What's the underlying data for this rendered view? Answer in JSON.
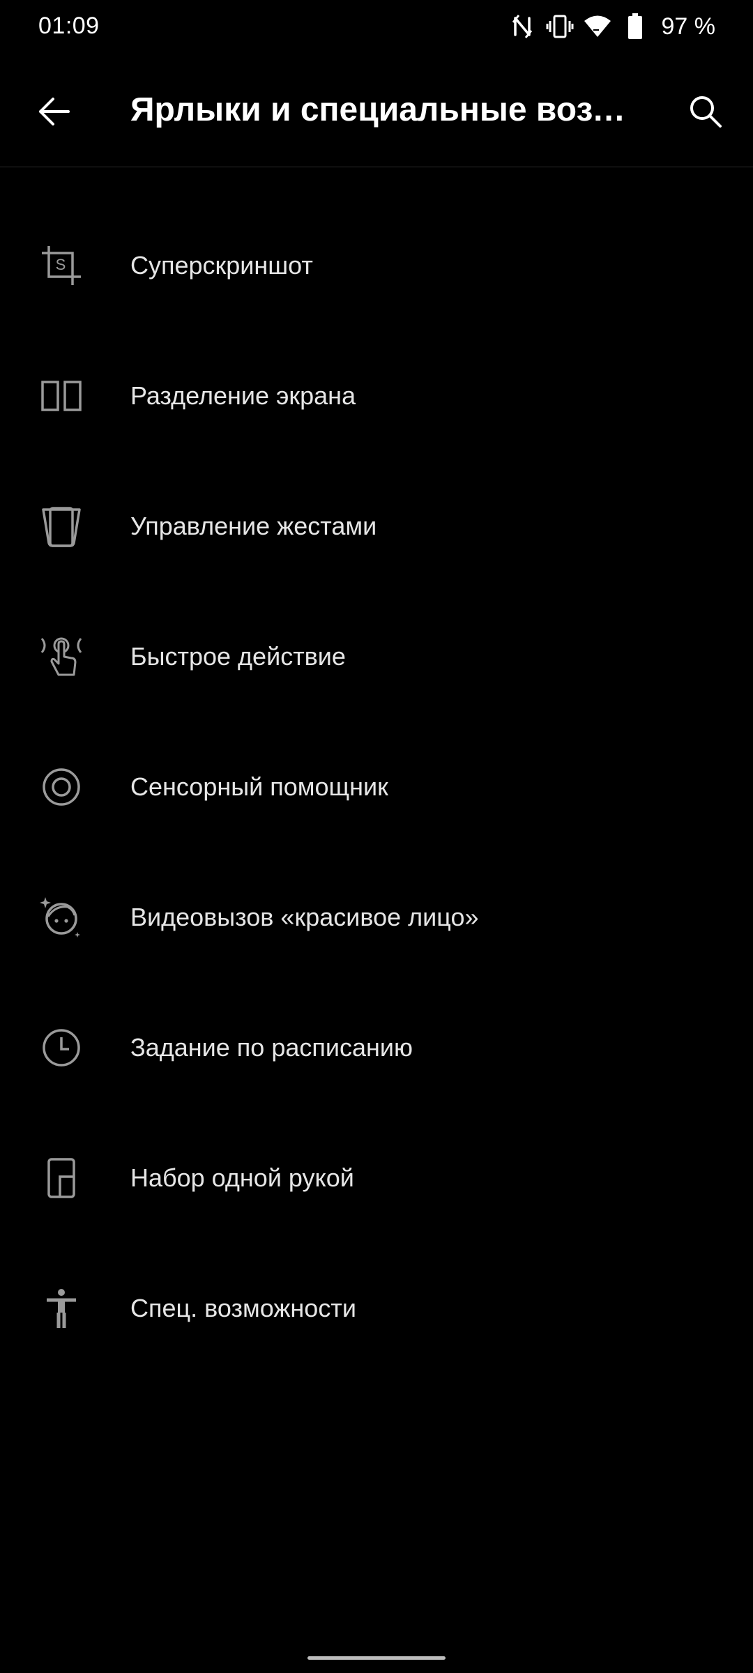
{
  "status_bar": {
    "time": "01:09",
    "battery": "97 %",
    "icons": [
      "nfc-icon",
      "vibrate-icon",
      "wifi-icon",
      "battery-icon"
    ]
  },
  "app_bar": {
    "title": "Ярлыки и специальные возм…",
    "back_icon": "arrow-left-icon",
    "search_icon": "search-icon"
  },
  "menu": {
    "items": [
      {
        "label": "Суперскриншот",
        "icon": "screenshot-crop-icon"
      },
      {
        "label": "Разделение экрана",
        "icon": "split-screen-icon"
      },
      {
        "label": "Управление жестами",
        "icon": "gesture-phone-icon"
      },
      {
        "label": "Быстрое действие",
        "icon": "quick-gesture-hand-icon"
      },
      {
        "label": "Сенсорный помощник",
        "icon": "touch-assistant-icon"
      },
      {
        "label": "Видеовызов «красивое лицо»",
        "icon": "beauty-face-icon"
      },
      {
        "label": "Задание по расписанию",
        "icon": "clock-icon"
      },
      {
        "label": "Набор одной рукой",
        "icon": "one-hand-phone-icon"
      },
      {
        "label": "Спец. возможности",
        "icon": "accessibility-icon"
      }
    ]
  },
  "colors": {
    "background": "#000000",
    "text_primary": "#ffffff",
    "text_secondary": "#e6e6e6",
    "icon": "#9a9a9a",
    "divider": "#2a2a2a"
  }
}
